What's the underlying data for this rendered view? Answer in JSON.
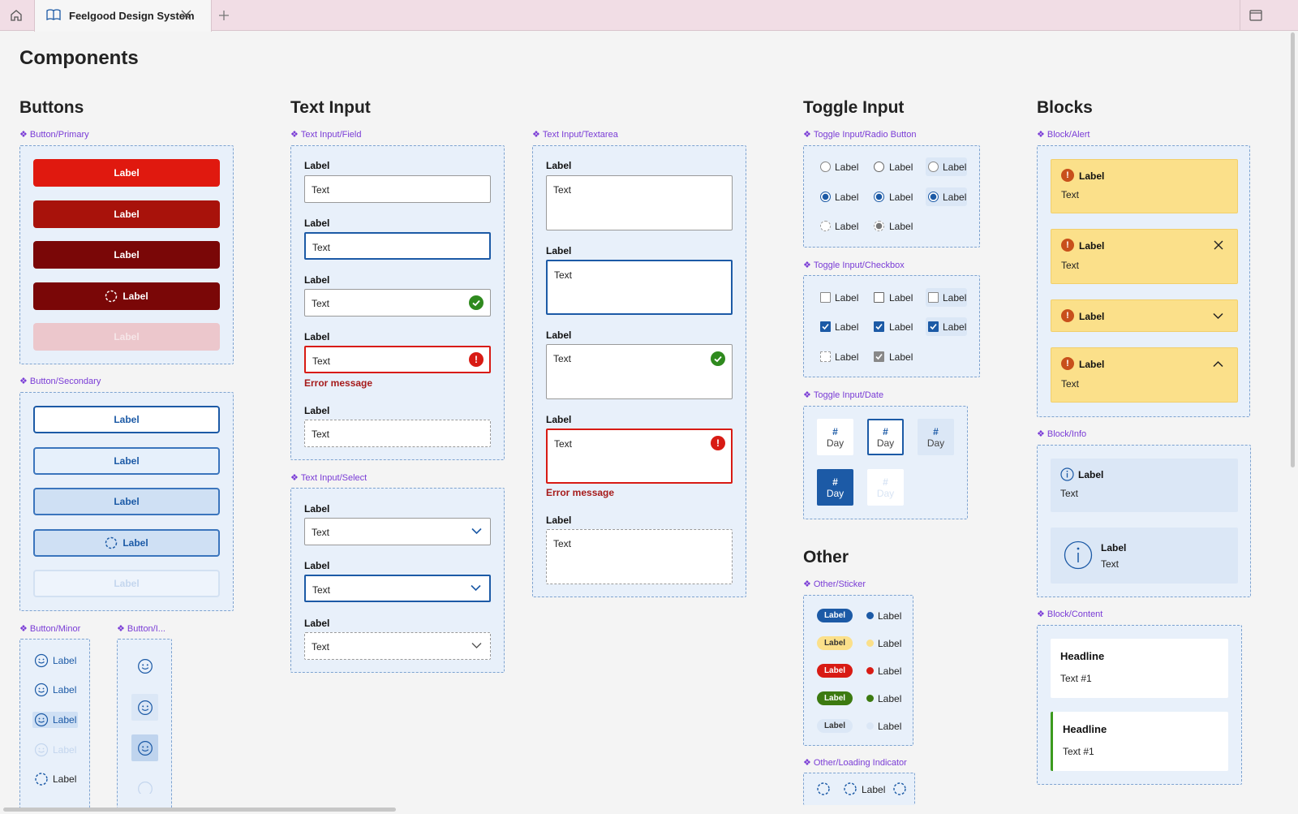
{
  "browser": {
    "tab_title": "Feelgood Design System"
  },
  "page": {
    "title": "Components"
  },
  "sections": {
    "buttons": "Buttons",
    "text_input": "Text Input",
    "toggle_input": "Toggle Input",
    "blocks": "Blocks",
    "other": "Other"
  },
  "components": {
    "button_primary": "Button/Primary",
    "button_secondary": "Button/Secondary",
    "button_minor": "Button/Minor",
    "button_icon": "Button/I...",
    "text_field": "Text Input/Field",
    "text_textarea": "Text Input/Textarea",
    "text_select": "Text Input/Select",
    "radio": "Toggle Input/Radio Button",
    "checkbox": "Toggle Input/Checkbox",
    "date": "Toggle Input/Date",
    "alert": "Block/Alert",
    "info": "Block/Info",
    "content": "Block/Content",
    "sticker": "Other/Sticker",
    "loading": "Other/Loading Indicator"
  },
  "common": {
    "label": "Label",
    "text": "Text",
    "error": "Error message",
    "hash": "#",
    "day": "Day",
    "headline": "Headline",
    "text1": "Text #1"
  },
  "colors": {
    "primary": "#e0190f",
    "primary_hover": "#a8120b",
    "primary_pressed": "#7a0707",
    "primary_disabled": "#ecc7cc",
    "secondary_border": "#1c5aa6",
    "success": "#2f8a1e",
    "error": "#d81b14",
    "alert_bg": "#fbe08a",
    "info_bg": "#dbe7f6",
    "accent_purple": "#7a3cd6"
  }
}
